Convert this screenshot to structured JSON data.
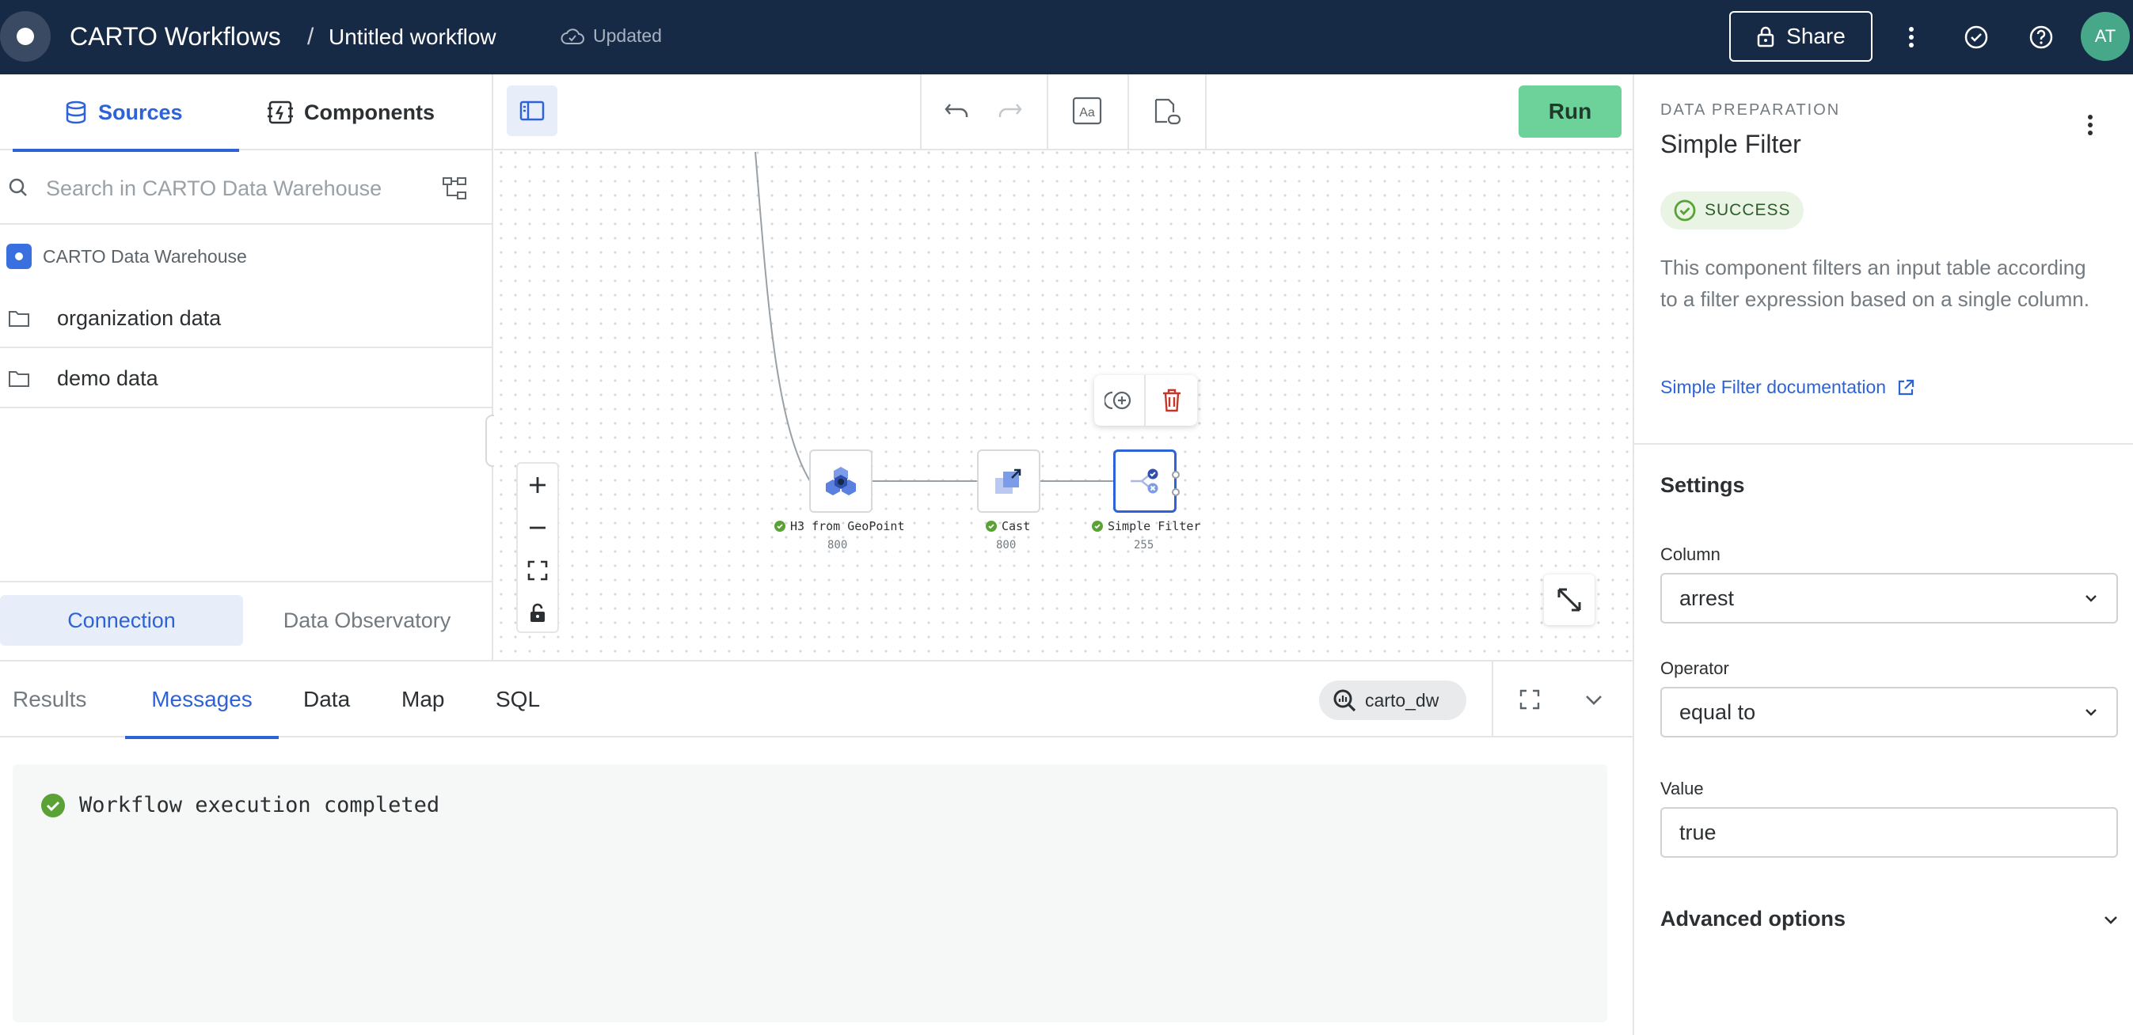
{
  "header": {
    "app_title": "CARTO Workflows",
    "separator": "/",
    "workflow_title": "Untitled workflow",
    "save_status": "Updated",
    "share_label": "Share",
    "avatar_initials": "AT"
  },
  "sidebar": {
    "tabs": [
      {
        "label": "Sources",
        "active": true
      },
      {
        "label": "Components",
        "active": false
      }
    ],
    "search_placeholder": "Search in CARTO Data Warehouse",
    "connection_name": "CARTO Data Warehouse",
    "folders": [
      "organization data",
      "demo data"
    ],
    "bottom_tabs": [
      {
        "label": "Connection",
        "active": true
      },
      {
        "label": "Data Observatory",
        "active": false
      }
    ]
  },
  "canvas": {
    "run_label": "Run",
    "nodes": [
      {
        "label": "H3 from GeoPoint",
        "count": "800",
        "status": "success"
      },
      {
        "label": "Cast",
        "count": "800",
        "status": "success"
      },
      {
        "label": "Simple Filter",
        "count": "255",
        "status": "success",
        "selected": true
      }
    ]
  },
  "bottom_panel": {
    "tabs": [
      {
        "label": "Results",
        "active": false
      },
      {
        "label": "Messages",
        "active": true
      },
      {
        "label": "Data",
        "active": false
      },
      {
        "label": "Map",
        "active": false
      },
      {
        "label": "SQL",
        "active": false
      }
    ],
    "connection_chip": "carto_dw",
    "message": "Workflow execution completed"
  },
  "right_panel": {
    "category": "DATA PREPARATION",
    "title": "Simple Filter",
    "status": "SUCCESS",
    "description": "This component filters an input table according to a filter expression based on a single column.",
    "doc_link": "Simple Filter documentation",
    "settings_title": "Settings",
    "column_label": "Column",
    "column_value": "arrest",
    "operator_label": "Operator",
    "operator_value": "equal to",
    "value_label": "Value",
    "value_value": "true",
    "advanced_label": "Advanced options"
  },
  "colors": {
    "header_bg": "#162945",
    "accent": "#2e63d8",
    "run_button": "#6dd29a",
    "success": "#5aa136",
    "avatar": "#47a889",
    "delete": "#c0392b"
  }
}
